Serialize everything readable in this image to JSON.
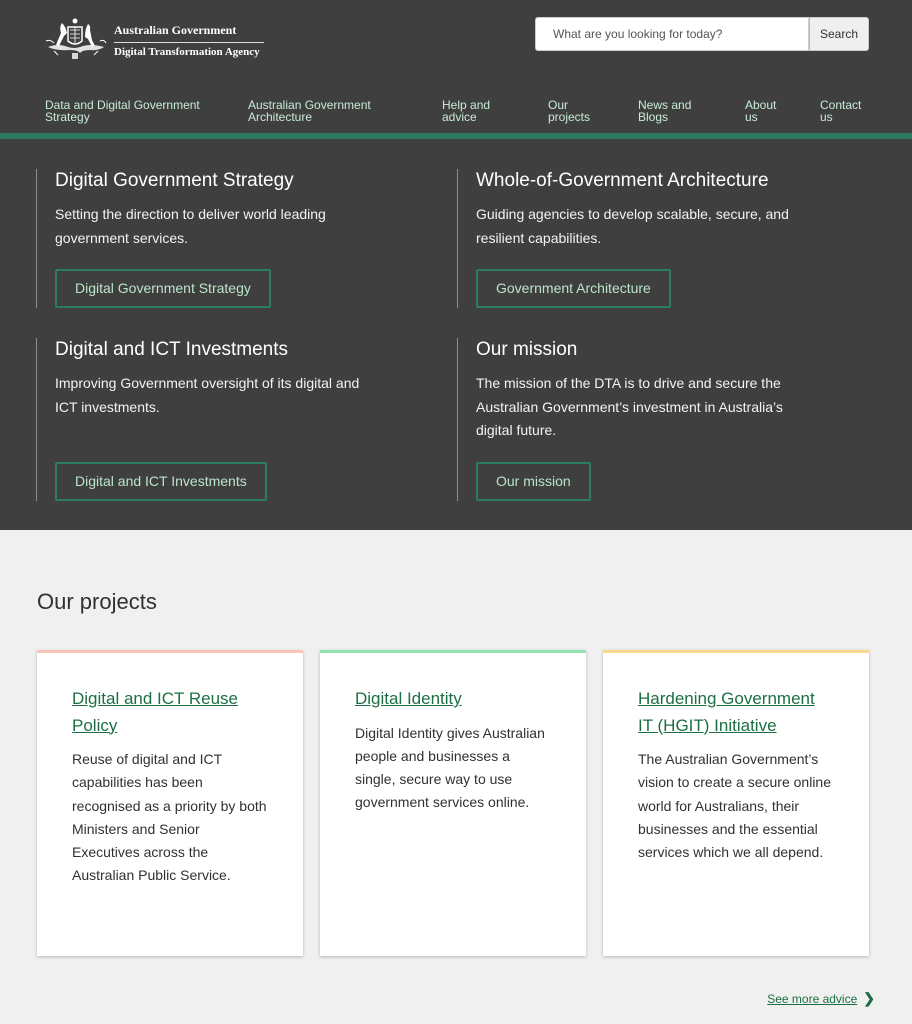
{
  "header": {
    "logo": {
      "line1": "Australian Government",
      "line2": "Digital Transformation Agency",
      "icon": "coat-of-arms-icon"
    },
    "search": {
      "placeholder": "What are you looking for today?",
      "value": "",
      "button_label": "Search"
    },
    "nav": [
      {
        "label": "Data and Digital Government Strategy"
      },
      {
        "label": "Australian Government Architecture"
      },
      {
        "label": "Help and advice"
      },
      {
        "label": "Our projects"
      },
      {
        "label": "News and Blogs"
      },
      {
        "label": "About us"
      },
      {
        "label": "Contact us"
      }
    ]
  },
  "features": [
    {
      "title": "Digital Government Strategy",
      "text": "Setting the direction to deliver world leading government services.",
      "button": "Digital Government Strategy"
    },
    {
      "title": "Whole-of-Government Architecture",
      "text": "Guiding agencies to develop scalable, secure, and resilient capabilities.",
      "button": "Government Architecture"
    },
    {
      "title": "Digital and ICT Investments",
      "text": "Improving Government oversight of its digital and ICT investments.",
      "button": "Digital and ICT Investments"
    },
    {
      "title": "Our mission",
      "text": "The mission of the DTA is to drive and secure the Australian Government’s investment in Australia’s digital future.",
      "button": "Our mission"
    }
  ],
  "projects": {
    "heading": "Our projects",
    "cards": [
      {
        "title": "Digital and ICT Reuse Policy",
        "text": "Reuse of digital and ICT capabilities has been recognised as a priority by both Ministers and Senior Executives across the Australian Public Service.",
        "accent": "#f7c6b8"
      },
      {
        "title": "Digital Identity",
        "text": "Digital Identity gives Australian people and businesses a single, secure way to use government services online.",
        "accent": "#8fe3b0"
      },
      {
        "title": "Hardening Government IT (HGIT) Initiative",
        "text": "The Australian Government’s vision to create a secure online world for Australians, their businesses and the essential services which we all depend.",
        "accent": "#f8da8a"
      }
    ],
    "see_more": "See more advice",
    "see_more_icon": "chevron-right-icon"
  },
  "colors": {
    "header_bg": "#3f3f3f",
    "brand_green": "#2b7d5d",
    "link_green": "#1d6f43",
    "nav_text": "#c8ecd5"
  }
}
